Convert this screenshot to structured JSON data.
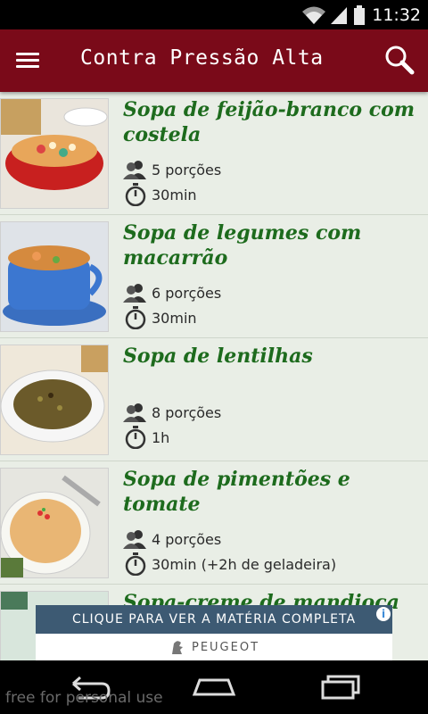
{
  "status_bar": {
    "time": "11:32"
  },
  "app_bar": {
    "title": "Contra Pressão Alta"
  },
  "recipes": [
    {
      "title": "Sopa de feijão-branco com costela",
      "servings": "5 porções",
      "time": "30min"
    },
    {
      "title": "Sopa de legumes com macarrão",
      "servings": "6 porções",
      "time": "30min"
    },
    {
      "title": "Sopa de lentilhas",
      "servings": "8 porções",
      "time": "1h"
    },
    {
      "title": "Sopa de pimentões e tomate",
      "servings": "4 porções",
      "time": "30min (+2h de geladeira)"
    },
    {
      "title": "Sopa-creme de mandioca",
      "servings": "",
      "time": ""
    }
  ],
  "ad": {
    "headline": "CLIQUE PARA VER A MATÉRIA COMPLETA",
    "brand": "PEUGEOT",
    "info": "i"
  },
  "watermark": "free for personal use",
  "colors": {
    "app_bar": "#7a0a19",
    "title_green": "#1d6b1d",
    "list_bg": "#e9eee6"
  }
}
